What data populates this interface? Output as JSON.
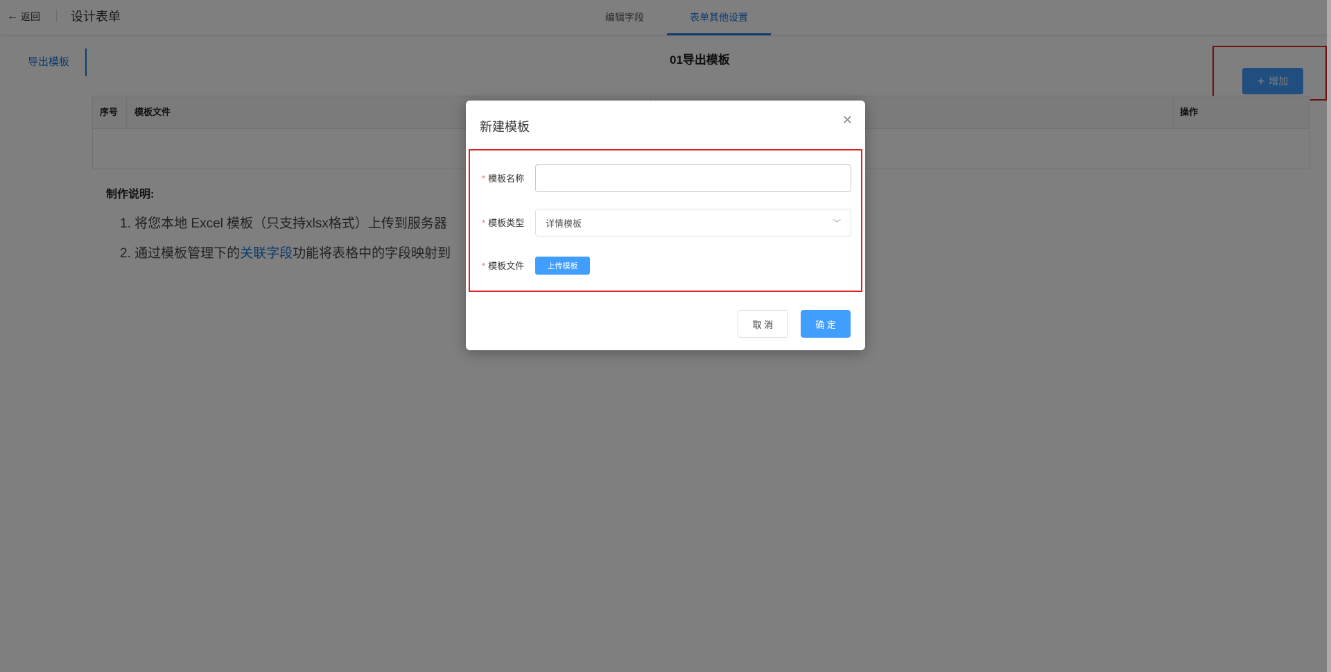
{
  "header": {
    "back_label": "返回",
    "title": "设计表单",
    "tabs": [
      {
        "label": "编辑字段",
        "active": false
      },
      {
        "label": "表单其他设置",
        "active": true
      }
    ]
  },
  "sidebar": {
    "items": [
      {
        "label": "导出模板",
        "active": true
      }
    ]
  },
  "main": {
    "section_title": "01导出模板",
    "add_button_label": "增加",
    "table": {
      "columns": [
        "序号",
        "模板文件",
        "操作"
      ],
      "rows": []
    },
    "instructions": {
      "title": "制作说明:",
      "line1": "1. 将您本地 Excel 模板（只支持xlsx格式）上传到服务器",
      "line2_before": "2. 通过模板管理下的",
      "line2_link": "关联字段",
      "line2_after": "功能将表格中的字段映射到"
    }
  },
  "dialog": {
    "title": "新建模板",
    "fields": {
      "name_label": "模板名称",
      "name_value": "",
      "type_label": "模板类型",
      "type_value": "详情模板",
      "file_label": "模板文件",
      "upload_label": "上传模板"
    },
    "cancel_label": "取 消",
    "ok_label": "确 定"
  },
  "colors": {
    "primary": "#409eff",
    "link": "#1e76d6",
    "highlight": "#e02020",
    "required": "#f56c6c"
  }
}
